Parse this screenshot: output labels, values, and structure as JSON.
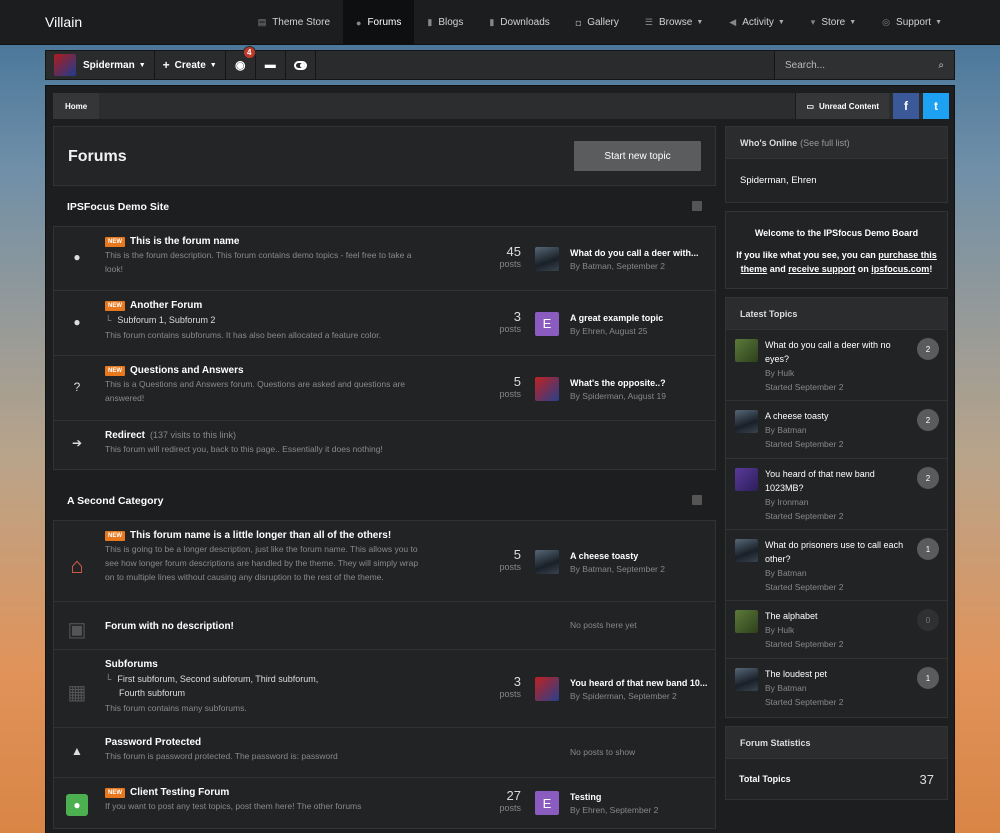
{
  "topnav": {
    "brand": "Villain",
    "links": [
      {
        "label": "Theme Store",
        "icon": "document-icon"
      },
      {
        "label": "Forums",
        "icon": "chat-icon",
        "active": true
      },
      {
        "label": "Blogs",
        "icon": "book-icon"
      },
      {
        "label": "Downloads",
        "icon": "download-icon"
      },
      {
        "label": "Gallery",
        "icon": "camera-icon"
      },
      {
        "label": "Browse",
        "icon": "list-icon",
        "caret": true
      },
      {
        "label": "Activity",
        "icon": "megaphone-icon",
        "caret": true
      },
      {
        "label": "Store",
        "icon": "cart-icon",
        "caret": true
      },
      {
        "label": "Support",
        "icon": "lifebuoy-icon",
        "caret": true
      }
    ]
  },
  "userbar": {
    "username": "Spiderman",
    "create": "Create",
    "notif_count": "4",
    "search_placeholder": "Search..."
  },
  "breadcrumb": {
    "home": "Home",
    "unread": "Unread Content"
  },
  "page": {
    "title": "Forums",
    "new_topic": "Start new topic"
  },
  "categories": [
    {
      "title": "IPSFocus Demo Site",
      "forums": [
        {
          "icon": "chat-bubbles-icon",
          "new": "NEW",
          "name": "This is the forum name",
          "desc": "This is the forum description. This forum contains demo topics - feel free to take a look!",
          "posts": "45",
          "posts_label": "posts",
          "last_title": "What do you call a deer with...",
          "last_by": "By Batman, September 2",
          "last_av": "batman"
        },
        {
          "icon": "chat-bubbles-icon",
          "new": "NEW",
          "name": "Another Forum",
          "subforums": "Subforum 1,  Subforum 2",
          "desc": "This forum contains subforums. It has also been allocated a feature color.",
          "posts": "3",
          "posts_label": "posts",
          "last_title": "A great example topic",
          "last_by": "By Ehren, August 25",
          "last_av": "e",
          "last_av_letter": "E"
        },
        {
          "icon": "question-icon",
          "new": "NEW",
          "name": "Questions and Answers",
          "desc": "This is a Questions and Answers forum. Questions are asked and questions are answered!",
          "posts": "5",
          "posts_label": "posts",
          "last_title": "What's the opposite..?",
          "last_by": "By Spiderman, August 19",
          "last_av": "spider"
        },
        {
          "icon": "arrow-right-icon",
          "name": "Redirect",
          "extra": "(137 visits to this link)",
          "desc": "This forum will redirect you, back to this page.. Essentially it does nothing!"
        }
      ]
    },
    {
      "title": "A Second Category",
      "forums": [
        {
          "icon": "house-icon",
          "new": "NEW",
          "name": "This forum name is a little longer than all of the others!",
          "desc": "This is going to be a longer description, just like the forum name. This allows you to see how longer forum descriptions are handled by the theme. They will simply wrap on to multiple lines without causing any disruption to the rest of the theme.",
          "posts": "5",
          "posts_label": "posts",
          "last_title": "A cheese toasty",
          "last_by": "By Batman, September 2",
          "last_av": "batman"
        },
        {
          "icon": "jacket-icon",
          "name": "Forum with no description!",
          "noposts": "No posts here yet"
        },
        {
          "icon": "clipboard-icon",
          "name": "Subforums",
          "subforums": "First subforum,   Second subforum,   Third subforum,",
          "subforums2": "Fourth subforum",
          "desc": "This forum contains many subforums.",
          "posts": "3",
          "posts_label": "posts",
          "last_title": "You heard of that new band 10...",
          "last_by": "By Spiderman, September 2",
          "last_av": "spider"
        },
        {
          "icon": "lock-icon",
          "name": "Password Protected",
          "desc": "This forum is password protected. The password is: password",
          "noposts": "No posts to show"
        },
        {
          "icon": "chat-green-icon",
          "new": "NEW",
          "name": "Client Testing Forum",
          "desc": "If you want to post any test topics, post them here! The other forums",
          "posts": "27",
          "posts_label": "posts",
          "last_title": "Testing",
          "last_by": "By Ehren, September 2",
          "last_av": "e",
          "last_av_letter": "E"
        }
      ]
    }
  ],
  "sidebar": {
    "online": {
      "title": "Who's Online",
      "sub": "(See full list)",
      "users": "Spiderman, Ehren"
    },
    "welcome": {
      "title": "Welcome to the IPSfocus Demo Board",
      "t1": "If you like what you see, you can",
      "purchase": "purchase this theme",
      "t2": "and",
      "support": "receive support",
      "t3": "on",
      "site": "ipsfocus.com",
      "t4": "!"
    },
    "latest": {
      "title": "Latest Topics",
      "items": [
        {
          "title": "What do you call a deer with no eyes?",
          "by": "By Hulk",
          "started": "Started September 2",
          "count": "2",
          "av": "hulk"
        },
        {
          "title": "A cheese toasty",
          "by": "By Batman",
          "started": "Started September 2",
          "count": "2",
          "av": "batman"
        },
        {
          "title": "You heard of that new band 1023MB?",
          "by": "By Ironman",
          "started": "Started September 2",
          "count": "2",
          "av": "iron"
        },
        {
          "title": "What do prisoners use to call each other?",
          "by": "By Batman",
          "started": "Started September 2",
          "count": "1",
          "av": "batman"
        },
        {
          "title": "The alphabet",
          "by": "By Hulk",
          "started": "Started September 2",
          "count": "0",
          "av": "hulk"
        },
        {
          "title": "The loudest pet",
          "by": "By Batman",
          "started": "Started September 2",
          "count": "1",
          "av": "batman"
        }
      ]
    },
    "stats": {
      "title": "Forum Statistics",
      "total_topics_label": "Total Topics",
      "total_topics": "37"
    }
  }
}
